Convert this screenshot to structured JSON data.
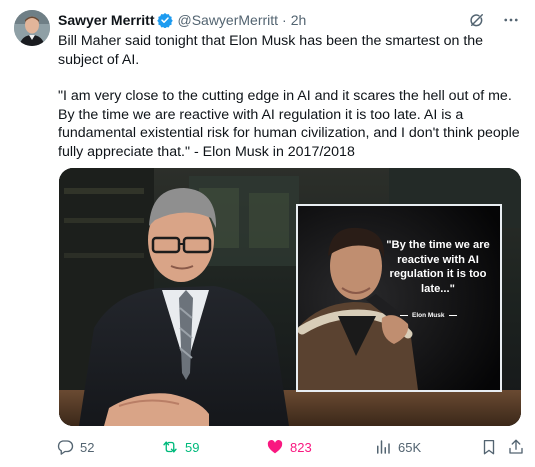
{
  "author": {
    "name": "Sawyer Merritt",
    "handle": "@SawyerMerritt",
    "separator": "·",
    "time": "2h"
  },
  "tweet": {
    "paragraph1": "Bill Maher said tonight that Elon Musk has been the smartest on the subject of AI.",
    "paragraph2": "\"I am very close to the cutting edge in AI and it scares the hell out of me. By the time we are reactive with AI regulation it is too late. AI is a fundamental existential risk for human civilization, and I don't think people fully appreciate that.\" - Elon Musk in 2017/2018"
  },
  "media": {
    "quote_card": {
      "quote": "\"By the time we are reactive with AI regulation it is too late...\"",
      "author": "Elon Musk"
    }
  },
  "actions": {
    "replies": "52",
    "reposts": "59",
    "likes": "823",
    "views": "65K"
  },
  "colors": {
    "accent": "#1d9bf0",
    "repost": "#00ba7c",
    "like": "#f91880",
    "muted": "#536471"
  },
  "icons": [
    "verified-badge-icon",
    "grok-icon",
    "more-icon",
    "reply-icon",
    "repost-icon",
    "like-icon",
    "views-icon",
    "bookmark-icon",
    "share-icon"
  ]
}
